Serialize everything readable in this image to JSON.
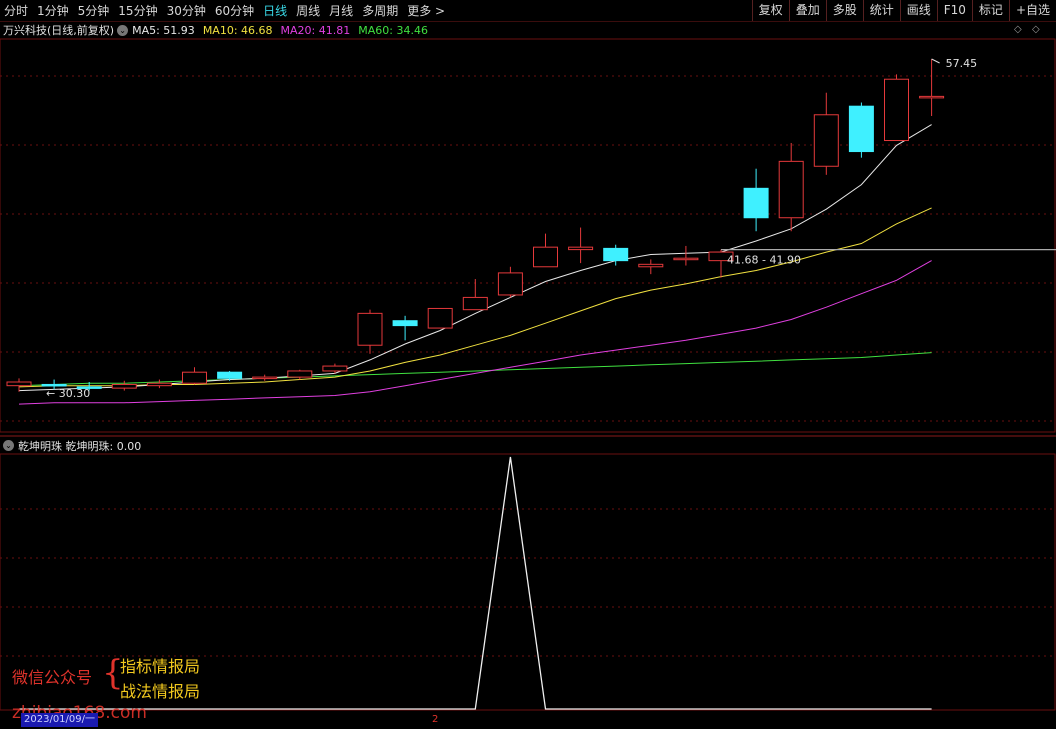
{
  "toolbar": {
    "periods": [
      "分时",
      "1分钟",
      "5分钟",
      "15分钟",
      "30分钟",
      "60分钟",
      "日线",
      "周线",
      "月线",
      "多周期",
      "更多 >"
    ],
    "active_period": "日线",
    "right_tools": [
      "复权",
      "叠加",
      "多股",
      "统计",
      "画线",
      "F10",
      "标记",
      "+自选"
    ]
  },
  "info": {
    "title": "万兴科技(日线,前复权)",
    "ma": [
      {
        "label": "MA5: 51.93",
        "color": "#e8e8e8"
      },
      {
        "label": "MA10: 46.68",
        "color": "#f0e040"
      },
      {
        "label": "MA20: 41.81",
        "color": "#e040e0"
      },
      {
        "label": "MA60: 34.46",
        "color": "#40e040"
      }
    ]
  },
  "sub_info": {
    "label": "乾坤明珠 乾坤明珠: 0.00"
  },
  "annotations": {
    "high_label": "57.45",
    "low_label": "← 30.30",
    "crosshair_label": "41.68 - 41.90"
  },
  "watermark": {
    "wechat": "微信公众号",
    "brace": "{",
    "line1": "指标情报局",
    "line2": "战法情报局",
    "url": "zhibiao168.com"
  },
  "footer": {
    "date": "2023/01/09/一",
    "page": "2"
  },
  "colors": {
    "up": "#e5393b",
    "down": "#3ff0ff",
    "ma5": "#e8e8e8",
    "ma10": "#f0e040",
    "ma20": "#e040e0",
    "ma60": "#40e040",
    "grid": "#6a1010"
  },
  "chart_data": {
    "type": "candlestick",
    "ylim": [
      28,
      59
    ],
    "candles": [
      {
        "o": 30.8,
        "c": 31.1,
        "h": 31.4,
        "l": 30.3
      },
      {
        "o": 30.9,
        "c": 30.8,
        "h": 31.3,
        "l": 30.5
      },
      {
        "o": 30.7,
        "c": 30.6,
        "h": 31.1,
        "l": 30.4
      },
      {
        "o": 30.6,
        "c": 30.9,
        "h": 31.2,
        "l": 30.4
      },
      {
        "o": 30.8,
        "c": 31.0,
        "h": 31.3,
        "l": 30.6
      },
      {
        "o": 31.0,
        "c": 31.9,
        "h": 32.3,
        "l": 30.9
      },
      {
        "o": 31.9,
        "c": 31.4,
        "h": 32.0,
        "l": 31.2
      },
      {
        "o": 31.4,
        "c": 31.5,
        "h": 31.7,
        "l": 31.2
      },
      {
        "o": 31.5,
        "c": 32.0,
        "h": 32.1,
        "l": 31.3
      },
      {
        "o": 32.0,
        "c": 32.4,
        "h": 32.6,
        "l": 31.8
      },
      {
        "o": 34.1,
        "c": 36.7,
        "h": 37.0,
        "l": 33.4
      },
      {
        "o": 36.1,
        "c": 35.7,
        "h": 36.5,
        "l": 34.5
      },
      {
        "o": 35.5,
        "c": 37.1,
        "h": 37.1,
        "l": 35.5
      },
      {
        "o": 37.0,
        "c": 38.0,
        "h": 39.5,
        "l": 37.0
      },
      {
        "o": 38.2,
        "c": 40.0,
        "h": 40.5,
        "l": 38.0
      },
      {
        "o": 40.5,
        "c": 42.1,
        "h": 43.2,
        "l": 40.5
      },
      {
        "o": 41.9,
        "c": 42.1,
        "h": 43.7,
        "l": 40.8
      },
      {
        "o": 42.0,
        "c": 41.0,
        "h": 42.3,
        "l": 40.6
      },
      {
        "o": 40.5,
        "c": 40.7,
        "h": 41.1,
        "l": 39.9
      },
      {
        "o": 41.2,
        "c": 41.2,
        "h": 42.2,
        "l": 40.6
      },
      {
        "o": 41.0,
        "c": 41.7,
        "h": 41.9,
        "l": 39.6
      },
      {
        "o": 46.9,
        "c": 44.5,
        "h": 48.5,
        "l": 43.4
      },
      {
        "o": 44.5,
        "c": 49.1,
        "h": 50.6,
        "l": 43.4
      },
      {
        "o": 48.7,
        "c": 52.9,
        "h": 54.7,
        "l": 48.0
      },
      {
        "o": 53.6,
        "c": 49.9,
        "h": 53.9,
        "l": 49.4
      },
      {
        "o": 50.8,
        "c": 55.8,
        "h": 56.2,
        "l": 50.8
      },
      {
        "o": 54.4,
        "c": 54.4,
        "h": 57.45,
        "l": 52.8
      }
    ],
    "ma5": [
      30.4,
      30.5,
      30.6,
      30.7,
      30.9,
      31.1,
      31.3,
      31.4,
      31.6,
      31.8,
      32.9,
      34.2,
      35.3,
      36.7,
      38.0,
      39.3,
      40.2,
      41.0,
      41.5,
      41.6,
      41.7,
      42.6,
      43.6,
      45.2,
      47.2,
      50.4,
      52.1
    ],
    "ma10": [
      30.7,
      30.8,
      30.8,
      30.8,
      30.9,
      30.9,
      31.0,
      31.1,
      31.3,
      31.5,
      32.0,
      32.7,
      33.3,
      34.1,
      34.9,
      35.9,
      36.9,
      37.9,
      38.6,
      39.1,
      39.7,
      40.2,
      40.9,
      41.7,
      42.4,
      44.0,
      45.3
    ],
    "ma20": [
      29.3,
      29.4,
      29.4,
      29.4,
      29.5,
      29.6,
      29.7,
      29.8,
      29.9,
      30.0,
      30.3,
      30.8,
      31.3,
      31.8,
      32.3,
      32.8,
      33.3,
      33.7,
      34.1,
      34.5,
      35.0,
      35.5,
      36.2,
      37.2,
      38.3,
      39.4,
      41.0
    ],
    "ma60": [
      30.8,
      30.9,
      31.0,
      31.0,
      31.1,
      31.2,
      31.3,
      31.4,
      31.5,
      31.6,
      31.7,
      31.8,
      31.9,
      32.0,
      32.1,
      32.2,
      32.3,
      32.4,
      32.5,
      32.6,
      32.7,
      32.8,
      32.9,
      33.0,
      33.1,
      33.3,
      33.5
    ],
    "indicator": {
      "name": "乾坤明珠",
      "ylim": [
        0,
        1
      ],
      "values": [
        0,
        0,
        0,
        0,
        0,
        0,
        0,
        0,
        0,
        0,
        0,
        0,
        0,
        0,
        1,
        0,
        0,
        0,
        0,
        0,
        0,
        0,
        0,
        0,
        0,
        0,
        0
      ]
    }
  }
}
